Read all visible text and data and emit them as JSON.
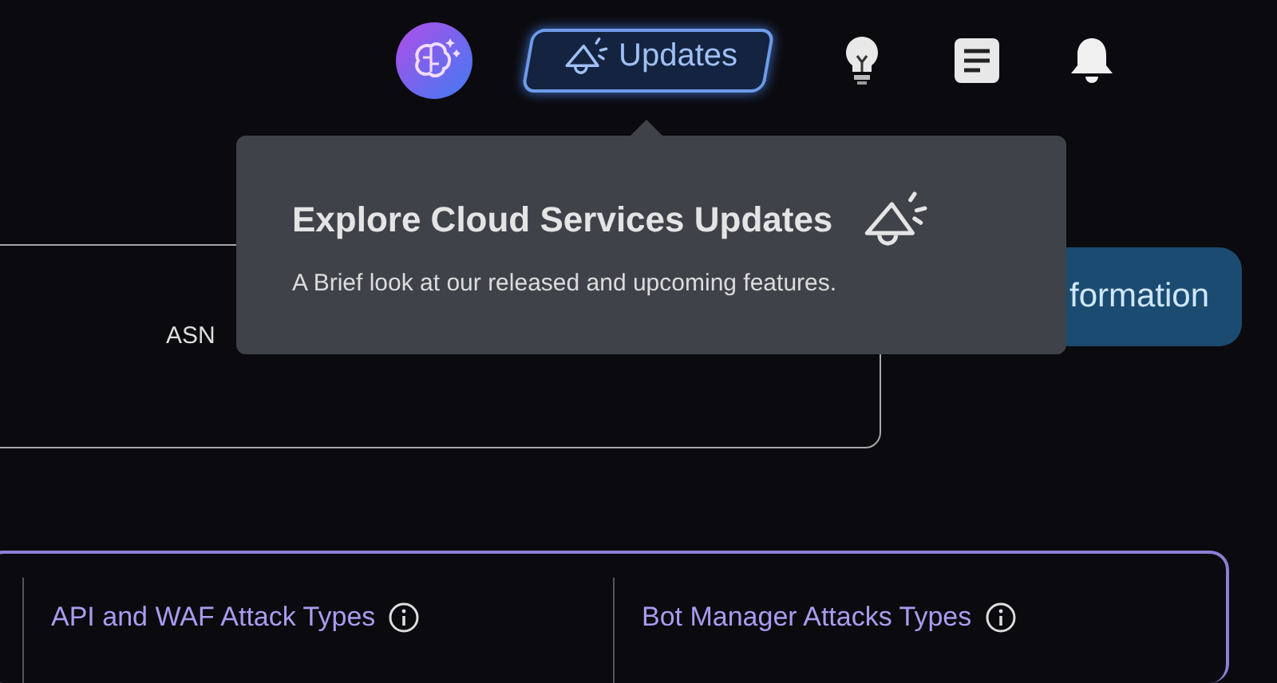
{
  "header": {
    "updates_button": {
      "label": "Updates"
    }
  },
  "asn_card": {
    "label": "ASN"
  },
  "info_button": {
    "label": "formation"
  },
  "attack_panel": {
    "columns": [
      {
        "title": "API and WAF Attack Types"
      },
      {
        "title": "Bot Manager Attacks Types"
      }
    ]
  },
  "popover": {
    "title": "Explore Cloud Services Updates",
    "text": "A Brief look at our released and upcoming features."
  }
}
